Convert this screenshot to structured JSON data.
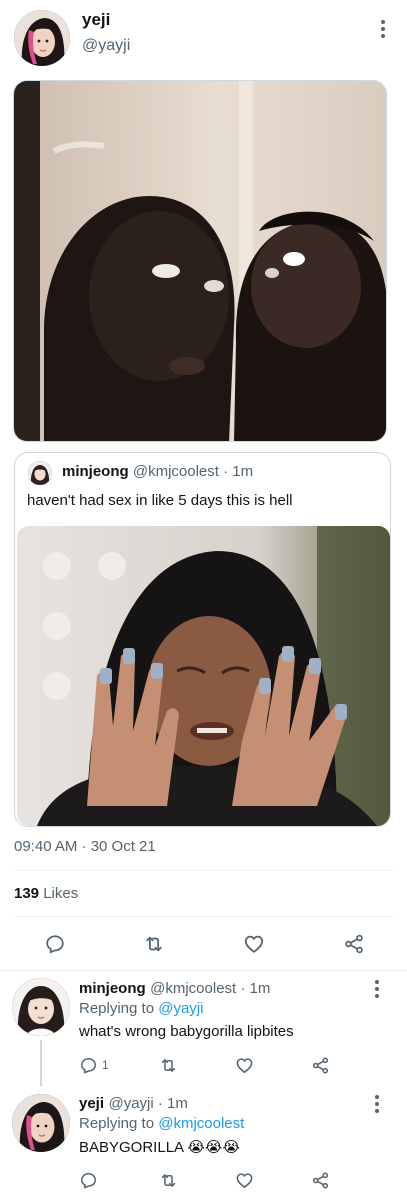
{
  "main_tweet": {
    "display_name": "yeji",
    "handle": "@yayji",
    "time": "09:40 AM · 30 Oct 21",
    "likes_count": "139",
    "likes_label": " Likes"
  },
  "quoted_tweet": {
    "display_name": "minjeong",
    "handle": "@kmjcoolest",
    "age": " · 1m",
    "text": "haven't had sex in like 5 days this is hell"
  },
  "replies": [
    {
      "display_name": "minjeong",
      "handle": "@kmjcoolest",
      "age": " · 1m",
      "replying_prefix": "Replying to ",
      "replying_to": "@yayji",
      "text": "what's wrong babygorilla lipbites",
      "reply_count": "1"
    },
    {
      "display_name": "yeji",
      "handle": "@yayji",
      "age": " · 1m",
      "replying_prefix": "Replying to ",
      "replying_to": "@kmjcoolest",
      "text": "BABYGORILLA 😭😭😭",
      "reply_count": ""
    }
  ],
  "icons": {
    "reply": "comment-icon",
    "retweet": "retweet-icon",
    "like": "heart-icon",
    "share": "share-icon",
    "more": "more-options-icon"
  },
  "colors": {
    "link": "#1d9bf0",
    "secondary_text": "#536471",
    "border": "#cfd9de"
  }
}
